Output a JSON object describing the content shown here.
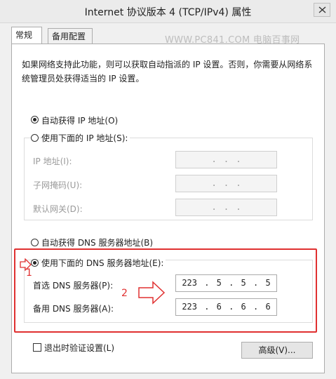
{
  "window": {
    "title": "Internet 协议版本 4 (TCP/IPv4) 属性",
    "close_icon": "close-icon"
  },
  "tabs": [
    {
      "label": "常规",
      "active": true
    },
    {
      "label": "备用配置",
      "active": false
    }
  ],
  "watermark": "WWW.PC841.COM 电脑百事网",
  "description": "如果网络支持此功能，则可以获取自动指派的 IP 设置。否则，你需要从网络系统管理员处获得适当的 IP 设置。",
  "ip": {
    "auto_label": "自动获得 IP 地址(O)",
    "manual_label": "使用下面的 IP 地址(S):",
    "auto_selected": true,
    "fields": [
      {
        "label": "IP 地址(I):",
        "value": ".  .  ."
      },
      {
        "label": "子网掩码(U):",
        "value": ".  .  ."
      },
      {
        "label": "默认网关(D):",
        "value": ".  .  ."
      }
    ]
  },
  "dns": {
    "auto_label": "自动获得 DNS 服务器地址(B)",
    "manual_label": "使用下面的 DNS 服务器地址(E):",
    "manual_selected": true,
    "preferred_label": "首选 DNS 服务器(P):",
    "preferred_value": "223 .  5  .  5  .  5",
    "alternate_label": "备用 DNS 服务器(A):",
    "alternate_value": "223 .  6  .  6  .  6"
  },
  "annotations": {
    "step1": "1",
    "step2": "2",
    "accent_color": "#e03030"
  },
  "validate_label": "退出时验证设置(L)",
  "advanced_button": "高级(V)..."
}
